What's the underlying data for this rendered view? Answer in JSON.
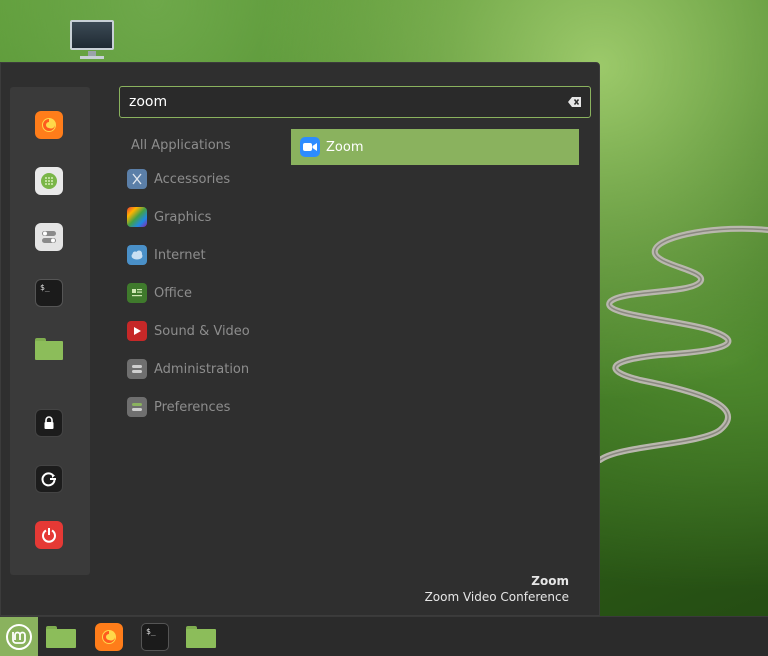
{
  "menu": {
    "search": {
      "value": "zoom"
    },
    "favorites": [
      {
        "name": "firefox-icon"
      },
      {
        "name": "software-manager-icon"
      },
      {
        "name": "settings-icon"
      },
      {
        "name": "terminal-icon"
      },
      {
        "name": "files-folder-icon"
      },
      {
        "name": "lock-screen-icon"
      },
      {
        "name": "logout-icon"
      },
      {
        "name": "power-icon"
      }
    ],
    "categories": {
      "all": "All Applications",
      "accessories": "Accessories",
      "graphics": "Graphics",
      "internet": "Internet",
      "office": "Office",
      "sound_video": "Sound & Video",
      "administration": "Administration",
      "preferences": "Preferences"
    },
    "results": [
      {
        "label": "Zoom",
        "icon": "zoom-icon"
      }
    ],
    "description": {
      "title": "Zoom",
      "subtitle": "Zoom Video Conference"
    }
  },
  "colors": {
    "accent": "#8ab25e",
    "menu_bg": "#2f2f2f",
    "panel_bg": "#2b2b2b"
  }
}
